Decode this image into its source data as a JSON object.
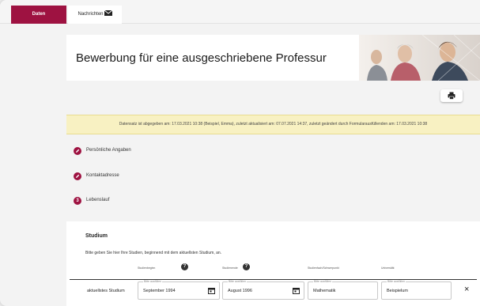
{
  "nav": {
    "tabs": [
      {
        "label": "Daten",
        "active": true
      },
      {
        "label": "Nachrichten",
        "icon": "envelope-icon"
      }
    ]
  },
  "header": {
    "title": "Bewerbung für eine ausgeschriebene Professur"
  },
  "toolbar": {
    "print_icon": "printer-icon"
  },
  "notice": {
    "text": "Datensatz ist abgegeben am: 17.03.2021 10:38 (Beispiel, Emma), zuletzt aktualisiert am: 07.07.2021 14:37, zuletzt geändert durch Formularausfüllenden am: 17.03.2021 10:38"
  },
  "steps": [
    {
      "label": "Persönliche Angaben",
      "state": "done",
      "icon": "pencil-icon"
    },
    {
      "label": "Kontaktadresse",
      "state": "done",
      "icon": "pencil-icon"
    },
    {
      "label": "Lebenslauf",
      "state": "current",
      "number": "3"
    }
  ],
  "studium": {
    "title": "Studium",
    "hint": "Bitte geben Sie hier Ihre Studien, beginnend mit dem aktuellsten Studium, an.",
    "columns": [
      "Studienbeginn",
      "Studienende",
      "Studienfach/Schwerpunkt",
      "Universität"
    ],
    "row_label": "aktuellstes Studium",
    "fields": [
      {
        "placeholder": "Bitte ausfüllen",
        "value": "September 1994"
      },
      {
        "placeholder": "Bitte ausfüllen",
        "value": "August 1996"
      },
      {
        "placeholder": "Bitte ausfüllen",
        "value": "Mathematik"
      },
      {
        "placeholder": "Bitte ausfüllen",
        "value": "Beispielum"
      }
    ],
    "help_symbol": "?",
    "remove_symbol": "×"
  },
  "colors": {
    "brand": "#9e1241",
    "notice_bg": "#f8f1c2"
  }
}
